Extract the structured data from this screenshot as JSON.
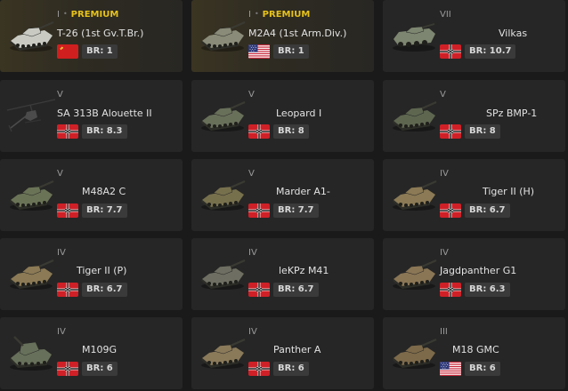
{
  "labels": {
    "premium": "PREMIUM",
    "separator": "•"
  },
  "vehicles": [
    {
      "rank": "I",
      "premium": true,
      "name": "T-26 (1st Gv.T.Br.)",
      "nation": "ussr",
      "br": "BR: 1",
      "icon": "tank-icon"
    },
    {
      "rank": "I",
      "premium": true,
      "name": "M2A4 (1st Arm.Div.)",
      "nation": "usa",
      "br": "BR: 1",
      "icon": "tank-icon"
    },
    {
      "rank": "VII",
      "premium": false,
      "name": "Vilkas",
      "nation": "germany",
      "br": "BR: 10.7",
      "icon": "wheeled-vehicle-icon"
    },
    {
      "rank": "V",
      "premium": false,
      "name": "SA 313B Alouette II",
      "nation": "germany",
      "br": "BR: 8.3",
      "icon": "helicopter-icon"
    },
    {
      "rank": "V",
      "premium": false,
      "name": "Leopard I",
      "nation": "germany",
      "br": "BR: 8",
      "icon": "tank-icon"
    },
    {
      "rank": "V",
      "premium": false,
      "name": "SPz BMP-1",
      "nation": "germany",
      "br": "BR: 8",
      "icon": "ifv-icon"
    },
    {
      "rank": "V",
      "premium": false,
      "name": "M48A2 C",
      "nation": "germany",
      "br": "BR: 7.7",
      "icon": "tank-icon"
    },
    {
      "rank": "V",
      "premium": false,
      "name": "Marder A1-",
      "nation": "germany",
      "br": "BR: 7.7",
      "icon": "ifv-icon"
    },
    {
      "rank": "IV",
      "premium": false,
      "name": "Tiger II (H)",
      "nation": "germany",
      "br": "BR: 6.7",
      "icon": "tank-icon"
    },
    {
      "rank": "IV",
      "premium": false,
      "name": "Tiger II (P)",
      "nation": "germany",
      "br": "BR: 6.7",
      "icon": "tank-icon"
    },
    {
      "rank": "IV",
      "premium": false,
      "name": "leKPz M41",
      "nation": "germany",
      "br": "BR: 6.7",
      "icon": "tank-icon"
    },
    {
      "rank": "IV",
      "premium": false,
      "name": "Jagdpanther G1",
      "nation": "germany",
      "br": "BR: 6.3",
      "icon": "tank-destroyer-icon"
    },
    {
      "rank": "IV",
      "premium": false,
      "name": "M109G",
      "nation": "germany",
      "br": "BR: 6",
      "icon": "artillery-icon"
    },
    {
      "rank": "IV",
      "premium": false,
      "name": "Panther A",
      "nation": "germany",
      "br": "BR: 6",
      "icon": "tank-icon"
    },
    {
      "rank": "III",
      "premium": false,
      "name": "M18 GMC",
      "nation": "usa",
      "br": "BR: 6",
      "icon": "tank-destroyer-icon"
    }
  ],
  "colors": {
    "premium": "#e7c21a",
    "card": "#262626",
    "background": "#1a1a1a",
    "br_badge": "#3a3a3a",
    "text": "#e2e2e2"
  }
}
